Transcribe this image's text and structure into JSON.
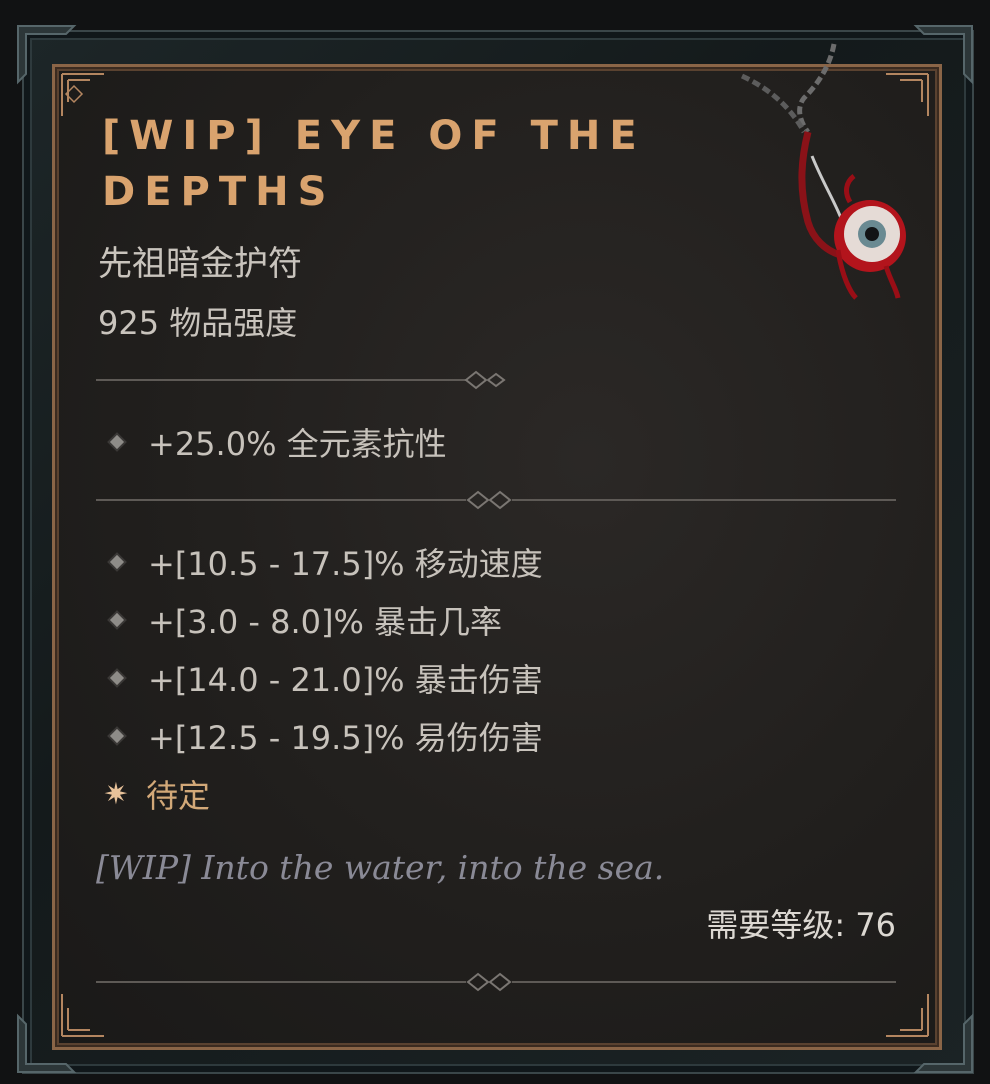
{
  "item": {
    "name": "[WIP] Eye of the Depths",
    "type": "先祖暗金护符",
    "power": "925 物品强度",
    "implicit": [
      {
        "text": "+25.0% 全元素抗性"
      }
    ],
    "affixes": [
      {
        "text": "+[10.5 - 17.5]% 移动速度"
      },
      {
        "text": "+[3.0 - 8.0]% 暴击几率"
      },
      {
        "text": "+[14.0 - 21.0]% 暴击伤害"
      },
      {
        "text": "+[12.5 - 19.5]% 易伤伤害"
      }
    ],
    "unique_power": "待定",
    "flavor": "[WIP] Into the water, into the sea.",
    "required_level": "需要等级: 76"
  },
  "icons": {
    "bullet": "diamond-bullet-icon",
    "unique": "sparkle-star-icon",
    "amulet": "eyeball-amulet-icon"
  },
  "colors": {
    "title": "#d9a36e",
    "unique_power": "#d2a878",
    "flavor": "#8a8a96",
    "border": "#8a6547"
  }
}
